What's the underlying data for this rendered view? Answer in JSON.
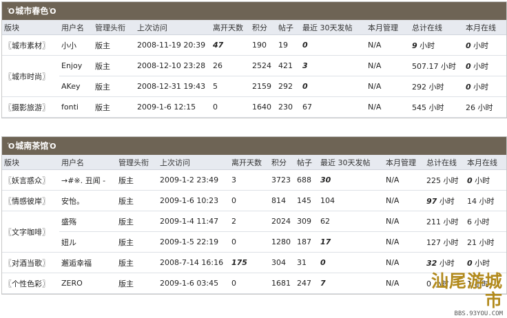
{
  "sections": [
    {
      "title": "城市春色",
      "headers": [
        "版块",
        "用户名",
        "管理头衔",
        "上次访问",
        "离开天数",
        "积分",
        "帖子",
        "最近 30天发帖",
        "本月管理",
        "总计在线",
        "本月在线"
      ],
      "groups": [
        {
          "forum": "〖城市素材〗",
          "rows": [
            {
              "user": "小小",
              "title": "版主",
              "last_visit": "2008-11-19 20:39",
              "days_away": "47",
              "points": "190",
              "posts": "19",
              "recent_posts": "0",
              "month_manage": "N/A",
              "total_online": "9",
              "month_online": "0"
            }
          ]
        },
        {
          "forum": "〖城市时尚〗",
          "rows": [
            {
              "user": "Enjoy",
              "title": "版主",
              "last_visit": "2008-12-10 23:28",
              "days_away": "26",
              "points": "2524",
              "posts": "421",
              "recent_posts": "3",
              "month_manage": "N/A",
              "total_online": "507.17",
              "month_online": "0"
            },
            {
              "user": "AKey",
              "title": "版主",
              "last_visit": "2008-12-31 19:43",
              "days_away": "5",
              "points": "2159",
              "posts": "292",
              "recent_posts": "0",
              "month_manage": "N/A",
              "total_online": "292",
              "month_online": "0"
            }
          ]
        },
        {
          "forum": "〖摄影旅游〗",
          "rows": [
            {
              "user": "fonti",
              "title": "版主",
              "last_visit": "2009-1-6 12:15",
              "days_away": "0",
              "points": "1640",
              "posts": "230",
              "recent_posts": "67",
              "month_manage": "N/A",
              "total_online": "545",
              "month_online": "26"
            }
          ]
        }
      ]
    },
    {
      "title": "城南茶馆",
      "headers": [
        "版块",
        "用户名",
        "管理头衔",
        "上次访问",
        "离开天数",
        "积分",
        "帖子",
        "最近 30天发帖",
        "本月管理",
        "总计在线",
        "本月在线"
      ],
      "groups": [
        {
          "forum": "〖妖言惑众〗",
          "rows": [
            {
              "user": "→#※. 丑闻 -",
              "title": "版主",
              "last_visit": "2009-1-2 23:49",
              "days_away": "3",
              "points": "3723",
              "posts": "688",
              "recent_posts": "30",
              "month_manage": "N/A",
              "total_online": "225",
              "month_online": "0"
            }
          ]
        },
        {
          "forum": "〖情感彼岸〗",
          "rows": [
            {
              "user": "安怡。",
              "title": "版主",
              "last_visit": "2009-1-6 10:23",
              "days_away": "0",
              "points": "814",
              "posts": "145",
              "recent_posts": "104",
              "month_manage": "N/A",
              "total_online": "97",
              "month_online": "14"
            }
          ]
        },
        {
          "forum": "〖文字咖啡〗",
          "rows": [
            {
              "user": "盛殇",
              "title": "版主",
              "last_visit": "2009-1-4 11:47",
              "days_away": "2",
              "points": "2024",
              "posts": "309",
              "recent_posts": "62",
              "month_manage": "N/A",
              "total_online": "211",
              "month_online": "6"
            },
            {
              "user": "妞ル",
              "title": "版主",
              "last_visit": "2009-1-5 22:19",
              "days_away": "0",
              "points": "1280",
              "posts": "187",
              "recent_posts": "17",
              "month_manage": "N/A",
              "total_online": "127",
              "month_online": "21"
            }
          ]
        },
        {
          "forum": "〖对酒当歌〗",
          "rows": [
            {
              "user": "邂逅幸福",
              "title": "版主",
              "last_visit": "2008-7-14 16:16",
              "days_away": "175",
              "points": "304",
              "posts": "31",
              "recent_posts": "0",
              "month_manage": "N/A",
              "total_online": "32",
              "month_online": "0"
            }
          ]
        },
        {
          "forum": "〖个性色彩〗",
          "rows": [
            {
              "user": "ZERO",
              "title": "版主",
              "last_visit": "2009-1-6 03:45",
              "days_away": "0",
              "points": "1681",
              "posts": "247",
              "recent_posts": "7",
              "month_manage": "N/A",
              "total_online": "0",
              "month_online": "1"
            }
          ]
        }
      ]
    }
  ],
  "emphasis": {
    "sections.0.groups.0.rows.0.days_away": true,
    "sections.0.groups.0.rows.0.recent_posts": true,
    "sections.0.groups.0.rows.0.total_online": true,
    "sections.0.groups.0.rows.0.month_online": true,
    "sections.0.groups.1.rows.0.recent_posts": true,
    "sections.0.groups.1.rows.0.month_online": true,
    "sections.0.groups.1.rows.1.recent_posts": true,
    "sections.0.groups.1.rows.1.month_online": true,
    "sections.1.groups.0.rows.0.recent_posts": true,
    "sections.1.groups.0.rows.0.month_online": true,
    "sections.1.groups.1.rows.0.total_online": true,
    "sections.1.groups.2.rows.1.recent_posts": true,
    "sections.1.groups.3.rows.0.days_away": true,
    "sections.1.groups.3.rows.0.recent_posts": true,
    "sections.1.groups.3.rows.0.total_online": true,
    "sections.1.groups.3.rows.0.month_online": true,
    "sections.1.groups.4.rows.0.recent_posts": true
  },
  "unit_hours": "小时",
  "watermark": {
    "brand": "汕尾游城市",
    "domain": "BBS.93YOU.COM"
  },
  "colors": {
    "title_bar": "#6e6455",
    "header_bg": "#e7eaf0",
    "watermark": "#b28a1c"
  }
}
